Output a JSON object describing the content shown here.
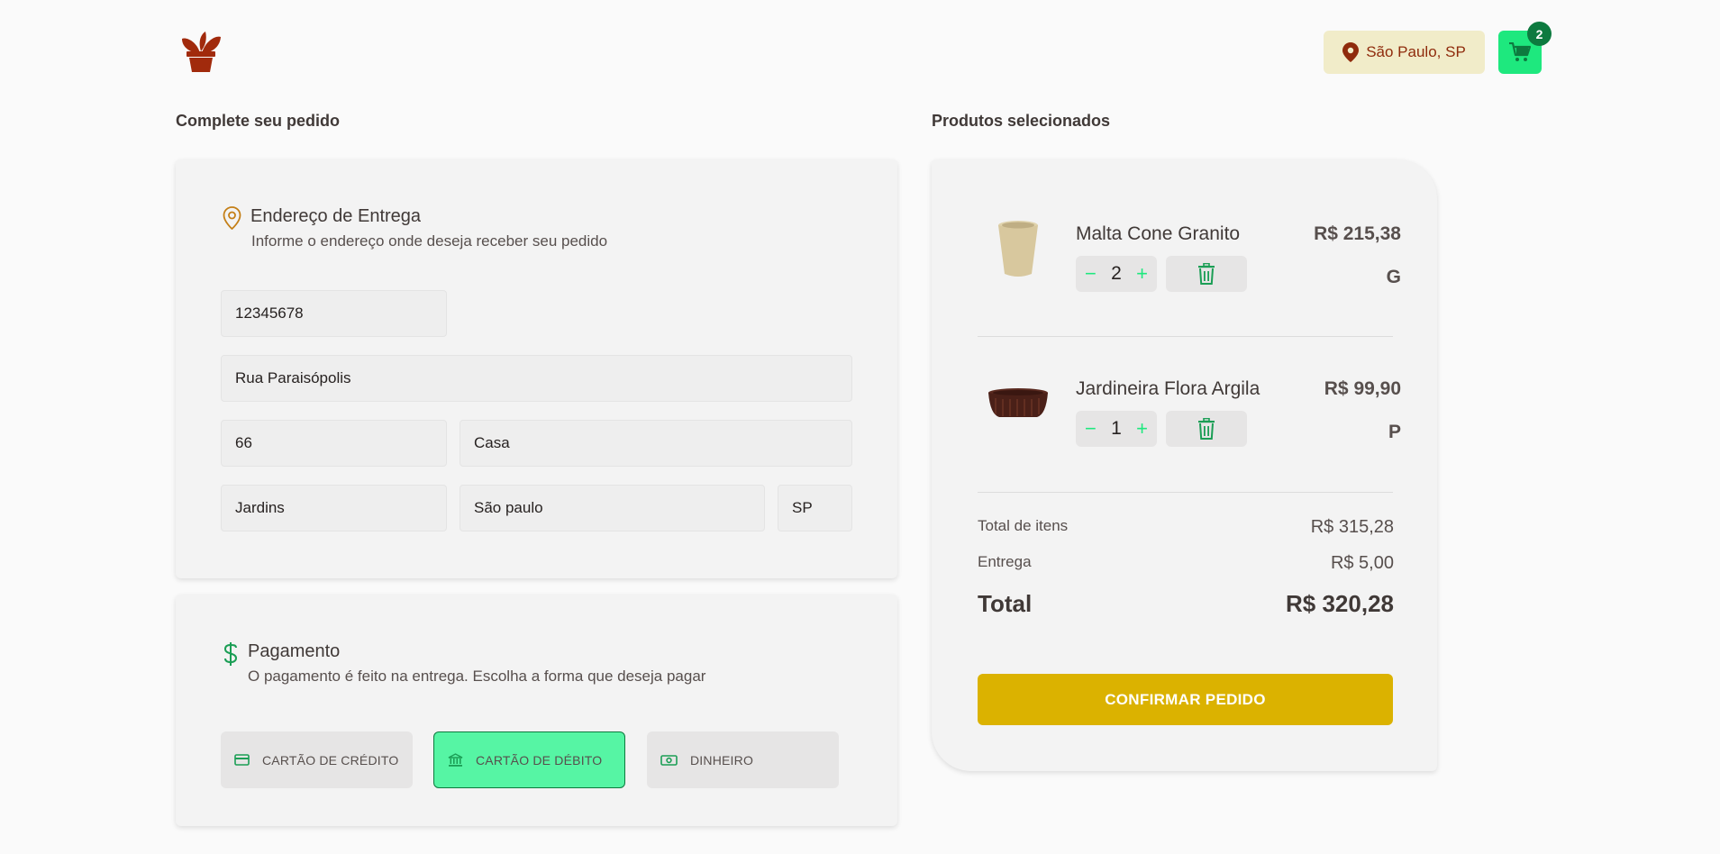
{
  "header": {
    "logo_icon": "plant-pot-icon",
    "location": "São Paulo, SP",
    "cart_count": "2"
  },
  "checkout": {
    "title": "Complete seu pedido",
    "address": {
      "title": "Endereço de Entrega",
      "subtitle": "Informe o endereço onde deseja receber seu pedido",
      "cep": "12345678",
      "street": "Rua Paraisópolis",
      "number": "66",
      "complement": "Casa",
      "neighborhood": "Jardins",
      "city": "São paulo",
      "uf": "SP"
    },
    "payment": {
      "title": "Pagamento",
      "subtitle": "O pagamento é feito na entrega. Escolha a forma que deseja pagar",
      "options": [
        "CARTÃO DE CRÉDITO",
        "CARTÃO DE DÉBITO",
        "DINHEIRO"
      ],
      "selected": "CARTÃO DE DÉBITO"
    }
  },
  "cart": {
    "title": "Produtos selecionados",
    "items": [
      {
        "name": "Malta Cone Granito",
        "price": "R$ 215,38",
        "size": "G",
        "qty": "2"
      },
      {
        "name": "Jardineira Flora Argila",
        "price": "R$ 99,90",
        "size": "P",
        "qty": "1"
      }
    ],
    "summary": {
      "items_label": "Total de itens",
      "items_value": "R$ 315,28",
      "delivery_label": "Entrega",
      "delivery_value": "R$ 5,00",
      "total_label": "Total",
      "total_value": "R$ 320,28"
    },
    "confirm_label": "CONFIRMAR PEDIDO"
  },
  "colors": {
    "brand": "#8f2b0c",
    "accent_green": "#1ee87e",
    "confirm_yellow": "#dbb200",
    "location_bg": "#f1ecc9"
  }
}
